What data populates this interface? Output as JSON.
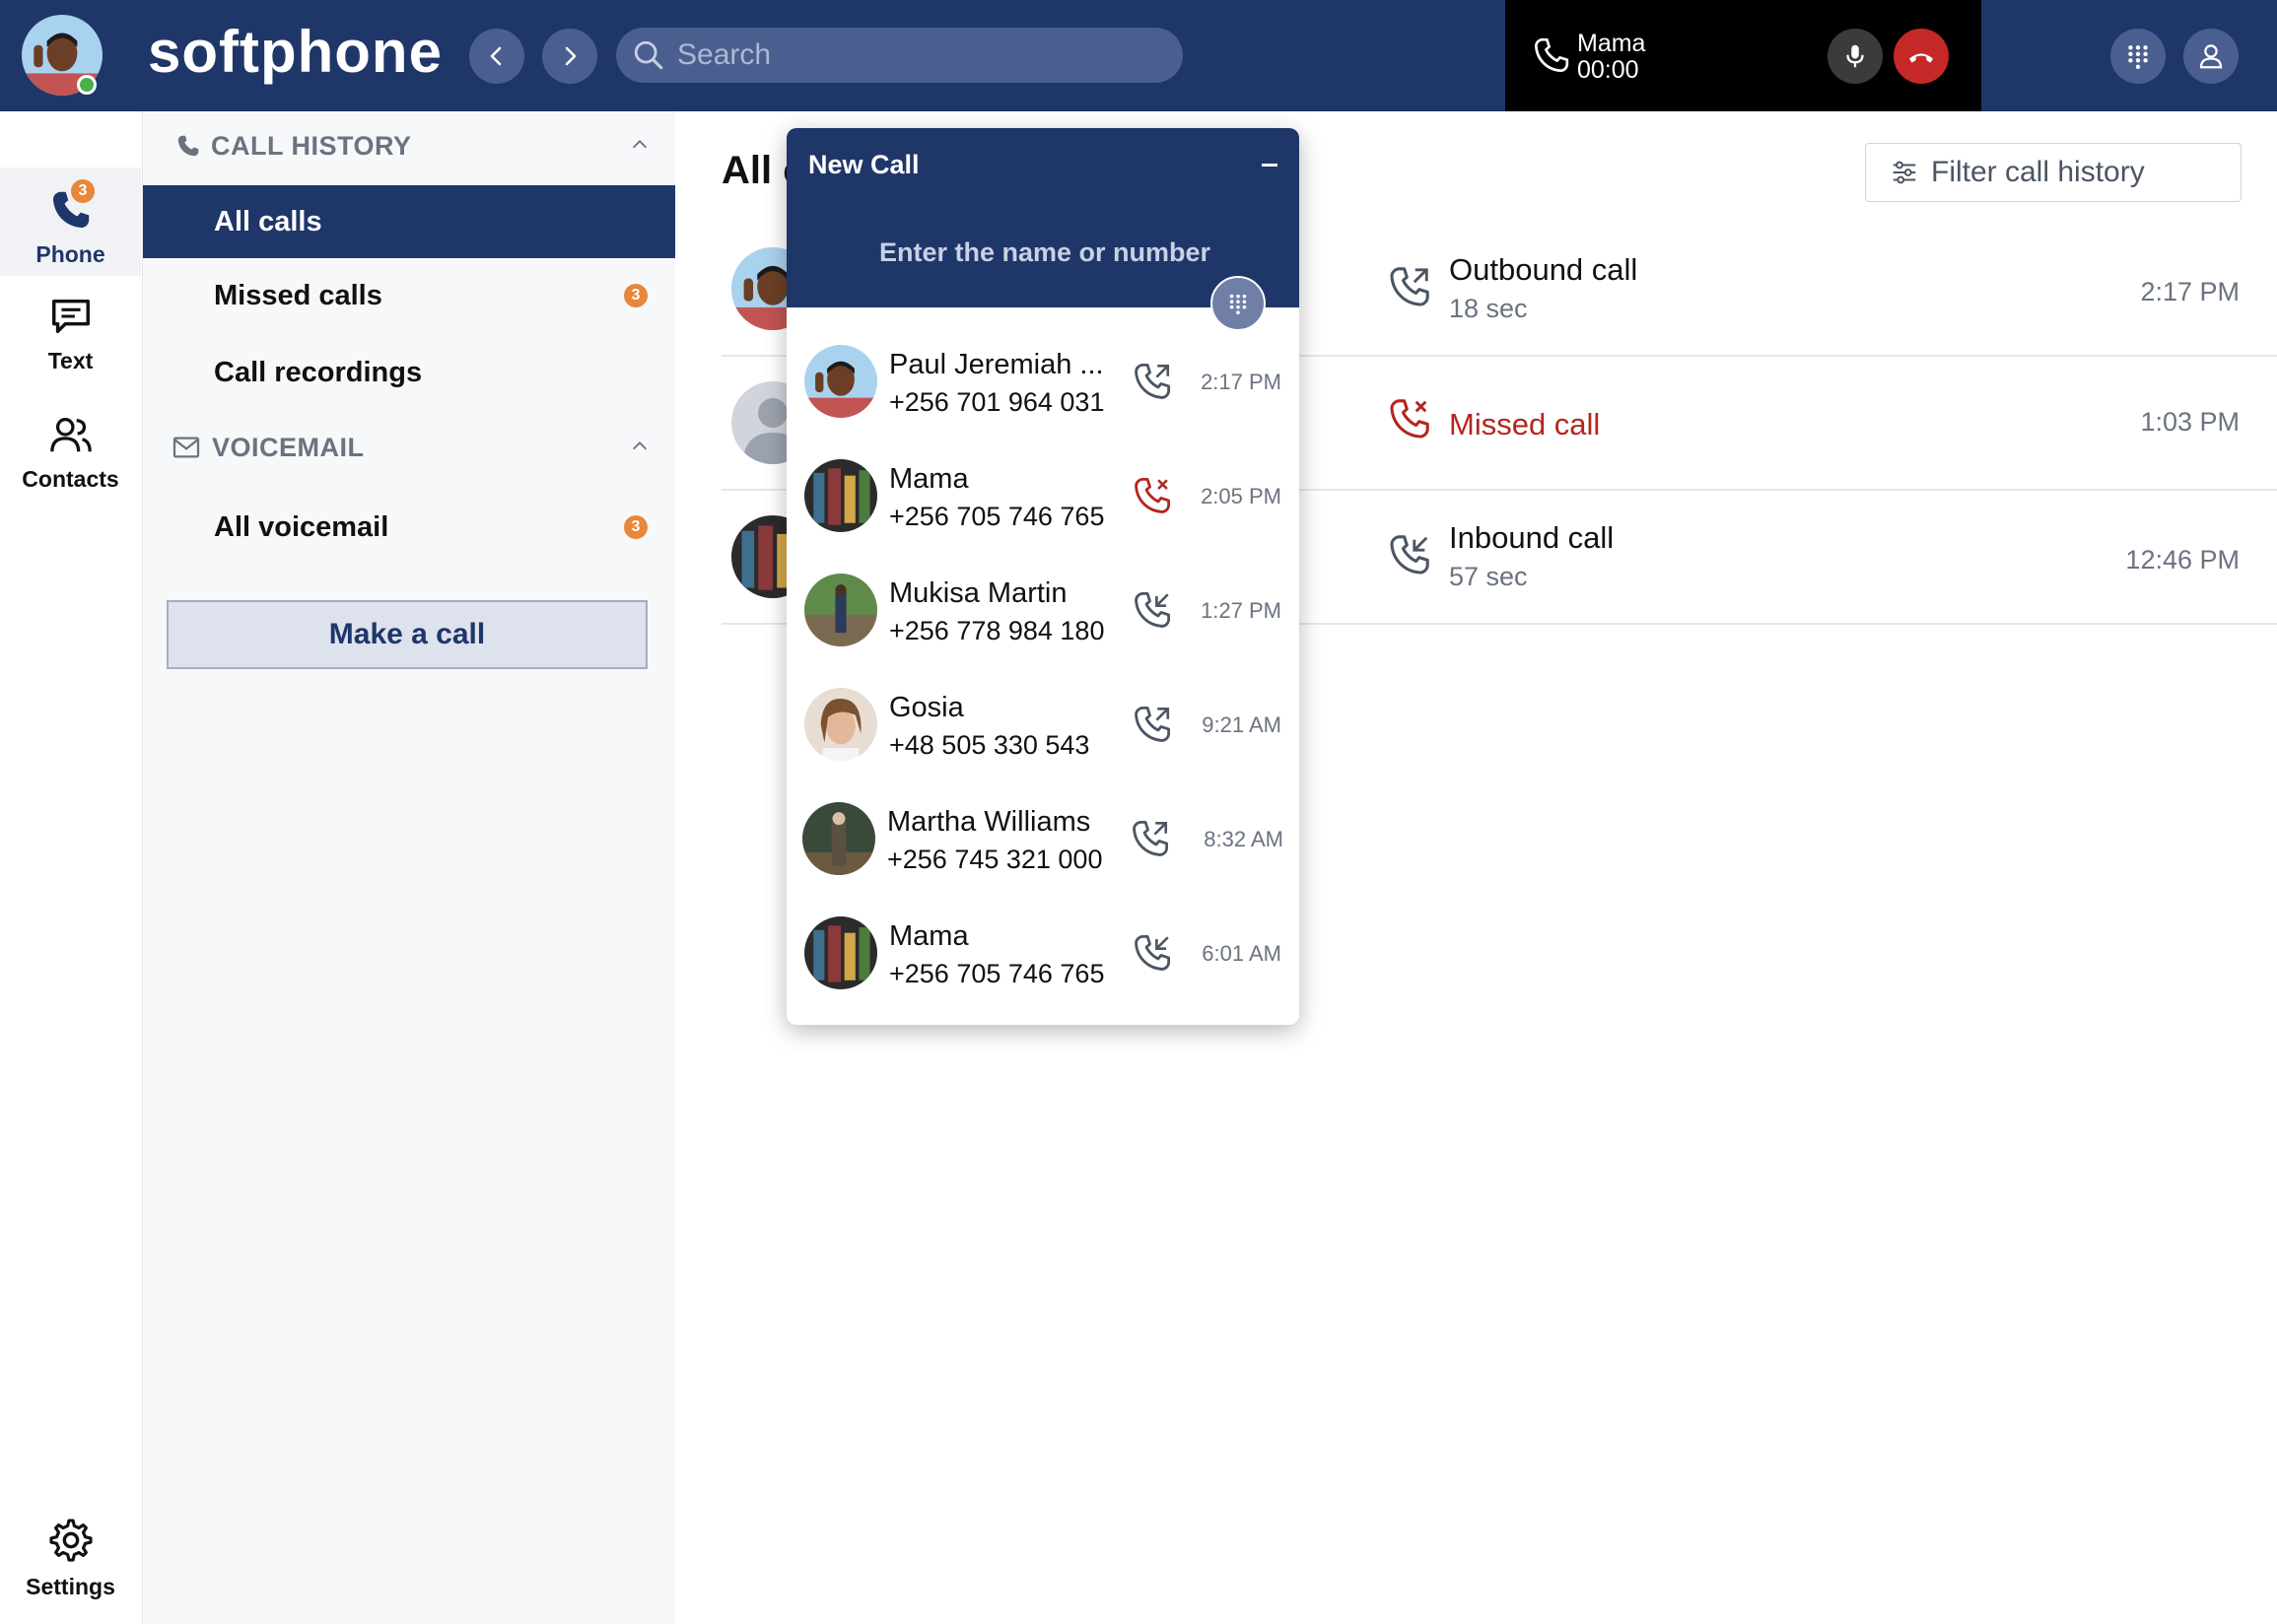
{
  "app": {
    "name": "softphone",
    "search_placeholder": "Search"
  },
  "active_call": {
    "name": "Mama",
    "duration": "00:00"
  },
  "rail": {
    "phone_label": "Phone",
    "phone_badge": "3",
    "text_label": "Text",
    "contacts_label": "Contacts",
    "settings_label": "Settings"
  },
  "sidebar": {
    "call_history_header": "CALL HISTORY",
    "items": [
      {
        "label": "All calls",
        "badge": ""
      },
      {
        "label": "Missed calls",
        "badge": "3"
      },
      {
        "label": "Call recordings",
        "badge": ""
      }
    ],
    "voicemail_header": "VOICEMAIL",
    "voicemail_items": [
      {
        "label": "All voicemail",
        "badge": "3"
      }
    ],
    "make_call_label": "Make a call"
  },
  "main": {
    "title_visible": "All c",
    "filter_placeholder": "Filter call history",
    "history": [
      {
        "type": "Outbound call",
        "duration": "18 sec",
        "time": "2:17 PM"
      },
      {
        "type": "Missed call",
        "duration": "",
        "time": "1:03 PM"
      },
      {
        "type": "Inbound call",
        "duration": "57 sec",
        "time": "12:46 PM"
      }
    ]
  },
  "new_call": {
    "title": "New Call",
    "input_placeholder": "Enter the name or number",
    "recents": [
      {
        "name": "Paul Jeremiah ...",
        "number": "+256 701 964 031",
        "time": "2:17 PM",
        "direction": "outbound"
      },
      {
        "name": "Mama",
        "number": "+256 705 746 765",
        "time": "2:05 PM",
        "direction": "missed"
      },
      {
        "name": "Mukisa Martin",
        "number": "+256 778 984 180",
        "time": "1:27 PM",
        "direction": "inbound"
      },
      {
        "name": "Gosia",
        "number": "+48 505 330 543",
        "time": "9:21 AM",
        "direction": "outbound"
      },
      {
        "name": "Martha Williams",
        "number": "+256 745 321 000",
        "time": "8:32 AM",
        "direction": "outbound"
      },
      {
        "name": "Mama",
        "number": "+256 705 746 765",
        "time": "6:01 AM",
        "direction": "inbound"
      }
    ]
  },
  "colors": {
    "brand_navy": "#1f3669",
    "badge_orange": "#e8873a",
    "missed_red": "#b3261e",
    "hangup_red": "#c62828"
  }
}
